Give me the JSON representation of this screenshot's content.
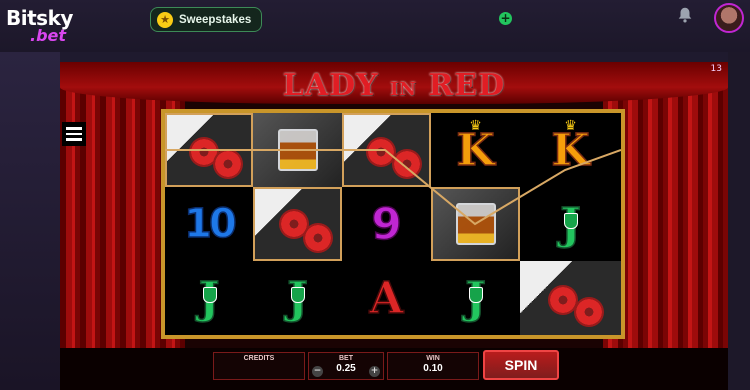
{
  "header": {
    "logo_top": "Bitsky",
    "logo_bottom": ".bet",
    "sweepstakes_label": "Sweepstakes",
    "add_label": "+"
  },
  "game": {
    "title_left": "LADY",
    "title_mid": "IN",
    "title_right": "RED",
    "badge": "13",
    "reels": [
      [
        "rose",
        "10",
        "J"
      ],
      [
        "glass",
        "rose",
        "J"
      ],
      [
        "rose",
        "9",
        "A"
      ],
      [
        "K",
        "glass",
        "J"
      ],
      [
        "K",
        "J",
        "rose"
      ]
    ],
    "controls": {
      "credits_label": "CREDITS",
      "credits_value": "",
      "bet_label": "BET",
      "bet_value": "0.25",
      "win_label": "WIN",
      "win_value": "0.10",
      "minus": "−",
      "plus": "+",
      "spin_label": "SPIN"
    }
  },
  "colors": {
    "accent": "#c026d3",
    "sweep_green": "#22c55e",
    "frame_gold": "#c9962a",
    "curtain_red": "#9e0c0c"
  }
}
